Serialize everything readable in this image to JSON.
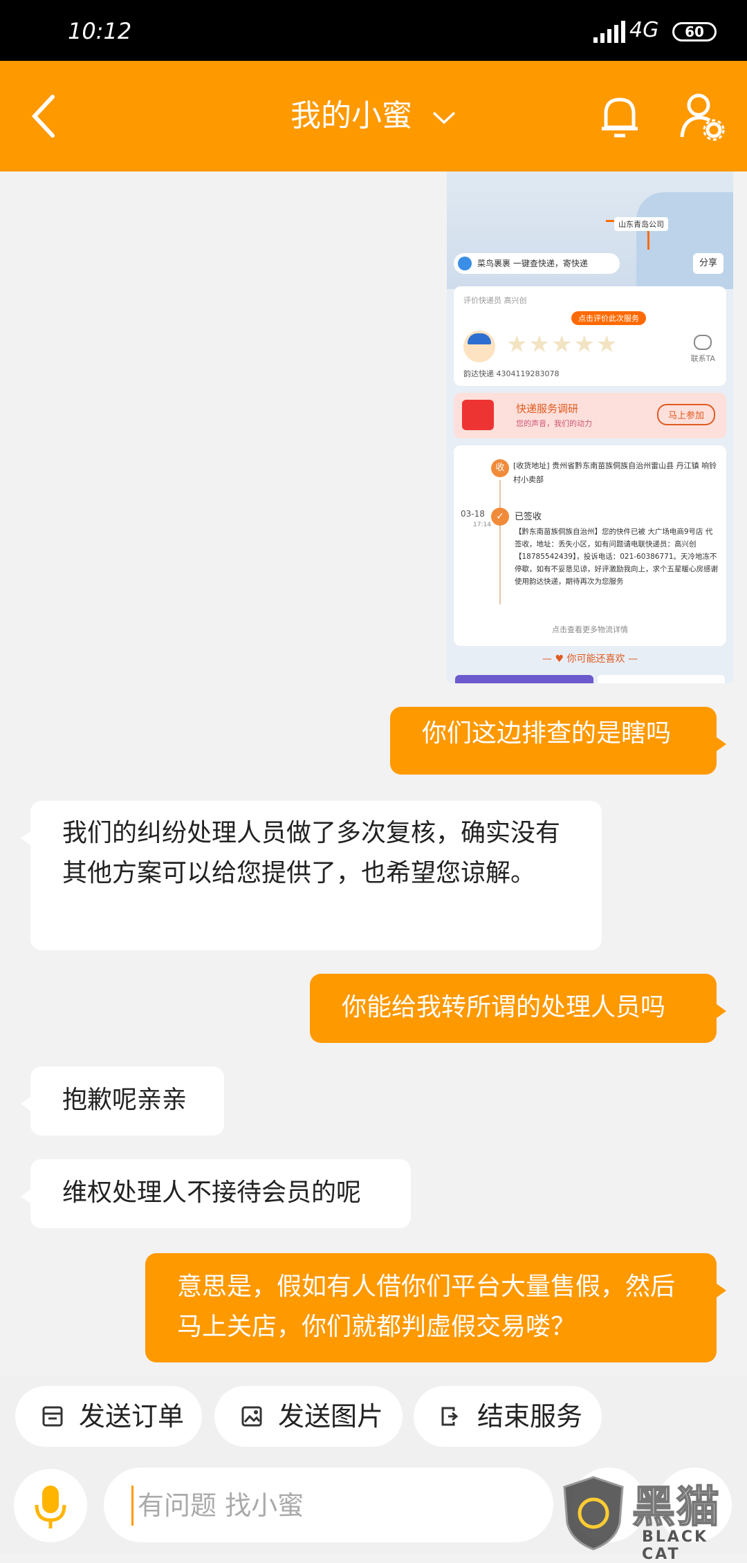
{
  "status_bar": {
    "time": "10:12",
    "network": "4G",
    "battery": "60"
  },
  "header": {
    "title": "我的小蜜"
  },
  "shared_image": {
    "map_tag": "山东青岛公司",
    "search_text": "菜鸟裹裹 一键查快递，寄快递",
    "share_label": "分享",
    "review_label": "评价快递员 高兴创",
    "review_pill": "点击评价此次服务",
    "contact_label": "联系TA",
    "tracking": "韵达快递 4304119283078",
    "survey_title": "快递服务调研",
    "survey_sub": "您的声音，我们的动力",
    "survey_button": "马上参加",
    "recv_icon": "收",
    "recv_addr": "[收货地址] 贵州省黔东南苗族侗族自治州雷山县 丹江镇  响铃村小卖部",
    "date": "03-18",
    "time": "17:14",
    "status": "已签收",
    "status_desc": "【黔东南苗族侗族自治州】您的快件已被 大广场电商9号店 代签收，地址：丢失小区，如有问题请电联快递员：高兴创【18785542439】，投诉电话：021-60386771。天冷地冻不停歇，如有不妥恳见谅，好评激励我向上，求个五星暖心房感谢使用韵达快递，期待再次为您服务",
    "more_link": "点击查看更多物流详情",
    "likes_label": "你可能还喜欢"
  },
  "messages": [
    {
      "from": "me",
      "text": "你们这边排查的是瞎吗"
    },
    {
      "from": "bot",
      "text": "我们的纠纷处理人员做了多次复核，确实没有其他方案可以给您提供了，也希望您谅解。"
    },
    {
      "from": "me",
      "text": "你能给我转所谓的处理人员吗"
    },
    {
      "from": "bot",
      "text": "抱歉呢亲亲"
    },
    {
      "from": "bot",
      "text": "维权处理人不接待会员的呢"
    },
    {
      "from": "me",
      "text": "意思是，假如有人借你们平台大量售假，然后马上关店，你们就都判虚假交易喽？"
    }
  ],
  "quick_actions": [
    {
      "label": "发送订单",
      "icon": "order-icon"
    },
    {
      "label": "发送图片",
      "icon": "image-icon"
    },
    {
      "label": "结束服务",
      "icon": "exit-icon"
    }
  ],
  "input": {
    "placeholder": "有问题 找小蜜"
  },
  "watermark": {
    "text_cn": "黑猫",
    "text_en": "BLACK CAT"
  },
  "colors": {
    "brand": "#ff9900",
    "background": "#f2f2f2"
  }
}
